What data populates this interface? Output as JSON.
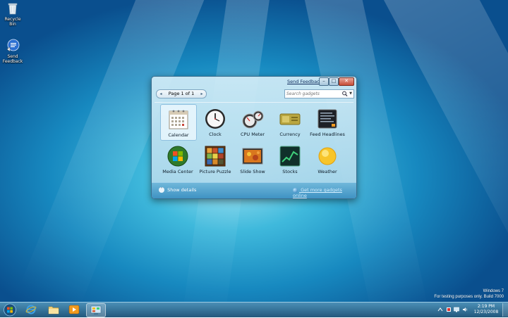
{
  "desktop": {
    "icons": [
      {
        "label": "Recycle Bin",
        "icon": "recycle-bin-icon"
      },
      {
        "label": "Send Feedback",
        "icon": "feedback-icon"
      }
    ],
    "watermark": {
      "line1": "Windows 7",
      "line2": "For testing purposes only. Build 7000"
    }
  },
  "gallery": {
    "send_feedback": "Send Feedback",
    "window_buttons": {
      "minimize": "–",
      "maximize": "□",
      "close": "✕"
    },
    "pager": {
      "text": "Page 1 of 1",
      "prev": "◂",
      "next": "▸"
    },
    "search": {
      "placeholder": "Search gadgets",
      "dropdown": "▼"
    },
    "gadgets": [
      {
        "label": "Calendar",
        "icon": "calendar-icon",
        "selected": true
      },
      {
        "label": "Clock",
        "icon": "clock-icon"
      },
      {
        "label": "CPU Meter",
        "icon": "cpu-meter-icon"
      },
      {
        "label": "Currency",
        "icon": "currency-icon"
      },
      {
        "label": "Feed Headlines",
        "icon": "feed-headlines-icon"
      },
      {
        "label": "Media Center",
        "icon": "media-center-icon"
      },
      {
        "label": "Picture Puzzle",
        "icon": "picture-puzzle-icon"
      },
      {
        "label": "Slide Show",
        "icon": "slide-show-icon"
      },
      {
        "label": "Stocks",
        "icon": "stocks-icon"
      },
      {
        "label": "Weather",
        "icon": "weather-icon"
      }
    ],
    "footer": {
      "show_details": "Show details",
      "chevron": "˅",
      "get_more": "Get more gadgets online"
    }
  },
  "taskbar": {
    "pinned": [
      {
        "icon": "internet-explorer-icon"
      },
      {
        "icon": "windows-explorer-icon"
      },
      {
        "icon": "media-player-icon"
      },
      {
        "icon": "gadget-gallery-icon",
        "active": true
      }
    ],
    "tray_icons": [
      "action-center-icon",
      "network-icon",
      "volume-icon"
    ],
    "clock": {
      "time": "2:19 PM",
      "date": "12/23/2008"
    }
  },
  "colors": {
    "accent": "#1e88c8",
    "taskbar": "#2d6a92",
    "close_button": "#c74f39"
  }
}
